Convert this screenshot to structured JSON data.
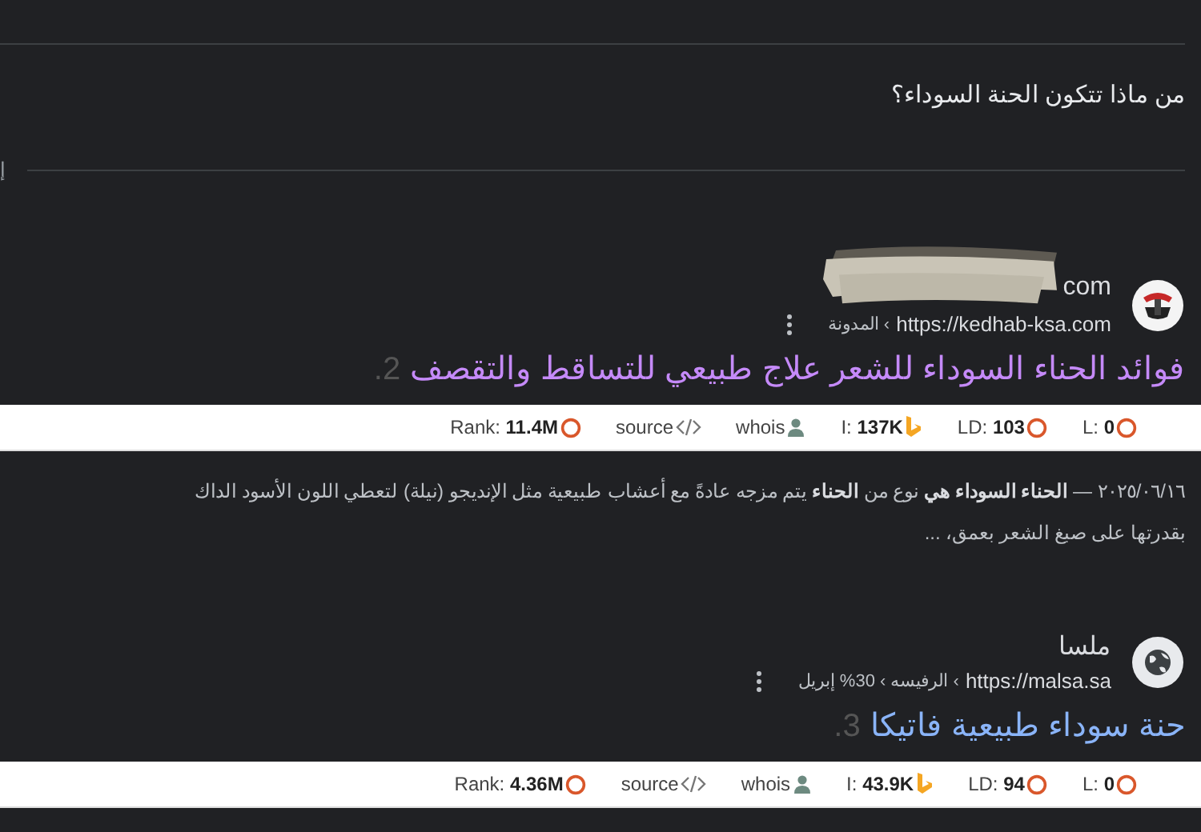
{
  "question": "من ماذا تتكون الحنة السوداء؟",
  "side_mark": "إ",
  "results": [
    {
      "number": "2.",
      "favicon": {
        "kind": "logo"
      },
      "redacted": true,
      "site_name": "com",
      "url": "https://kedhab-ksa.com",
      "breadcrumb": "› المدونة",
      "title": "فوائد الحناء السوداء للشعر علاج طبيعي للتساقط والتقصف",
      "visited": true,
      "stats": [
        {
          "kind": "l",
          "label": "L:",
          "value": "0"
        },
        {
          "kind": "ld",
          "label": "LD:",
          "value": "103"
        },
        {
          "kind": "index",
          "label": "I:",
          "value": "137K"
        },
        {
          "kind": "whois",
          "label": "whois"
        },
        {
          "kind": "source",
          "label": "source"
        },
        {
          "kind": "rank",
          "label": "Rank:",
          "value": "11.4M"
        }
      ],
      "snippet": [
        "٢٠٢٥/٠٦/١٦ — **الحناء السوداء هي** نوع من **الحناء** يتم مزجه عادةً مع أعشاب طبيعية مثل الإنديجو (نيلة) لتعطي اللون الأسود الداك",
        "بقدرتها على صبغ الشعر بعمق، ..."
      ]
    },
    {
      "number": "3.",
      "favicon": {
        "kind": "globe"
      },
      "redacted": false,
      "site_name": "ملسا",
      "url": "https://malsa.sa",
      "breadcrumb": "› الرفيسه › 30% إبريل",
      "title": "حنة سوداء طبيعية فاتيكا",
      "visited": false,
      "stats": [
        {
          "kind": "l",
          "label": "L:",
          "value": "0"
        },
        {
          "kind": "ld",
          "label": "LD:",
          "value": "94"
        },
        {
          "kind": "index",
          "label": "I:",
          "value": "43.9K"
        },
        {
          "kind": "whois",
          "label": "whois"
        },
        {
          "kind": "source",
          "label": "source"
        },
        {
          "kind": "rank",
          "label": "Rank:",
          "value": "4.36M"
        }
      ]
    }
  ]
}
